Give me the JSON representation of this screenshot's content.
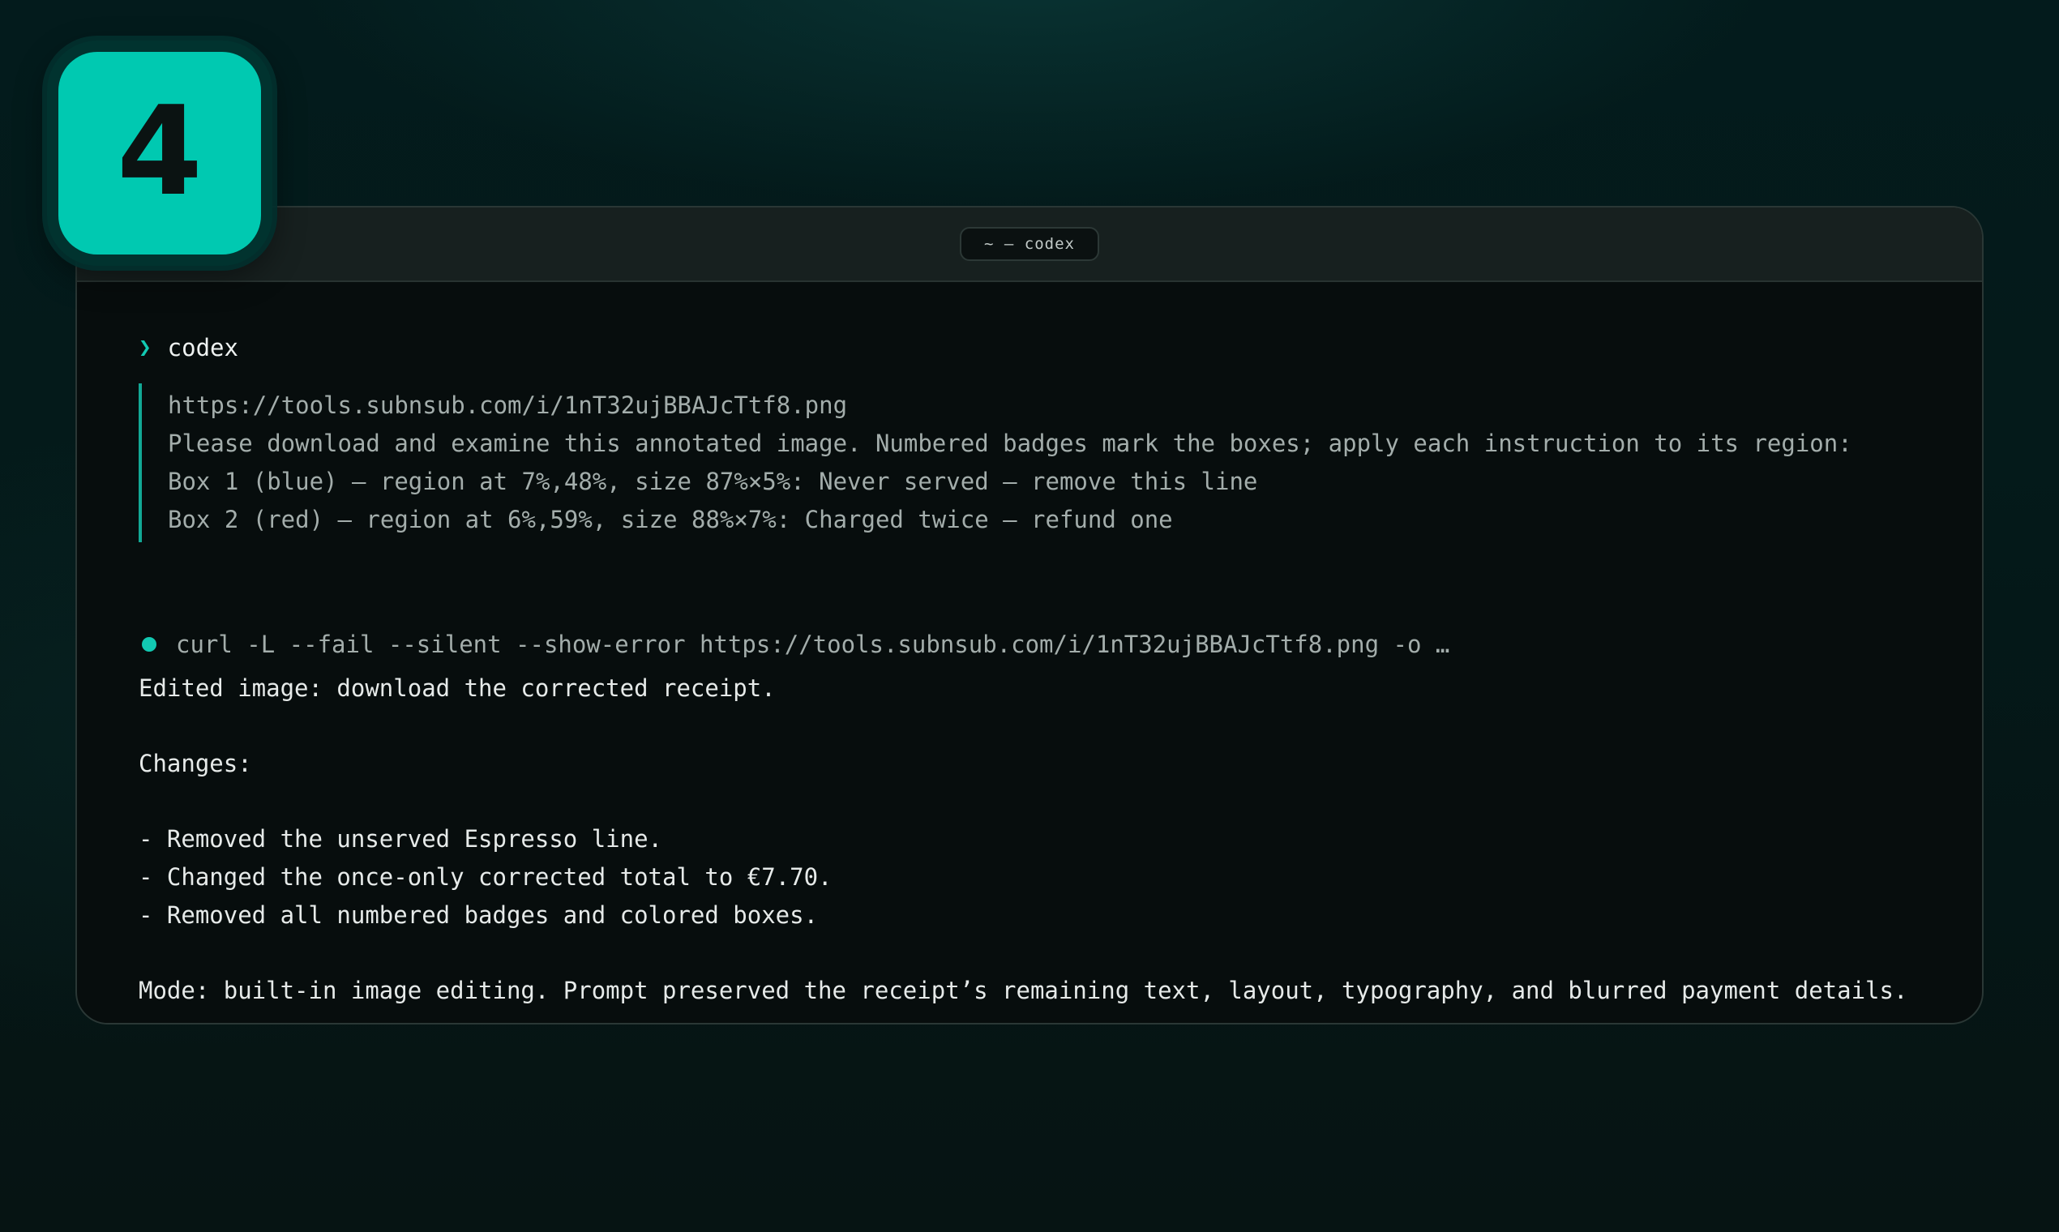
{
  "step": {
    "number": "4"
  },
  "window": {
    "title": "~ — codex"
  },
  "prompt": {
    "symbol": "❯",
    "command": "codex"
  },
  "message": {
    "lines": [
      "https://tools.subnsub.com/i/1nT32ujBBAJcTtf8.png",
      "Please download and examine this annotated image. Numbered badges mark the boxes; apply each instruction to its region:",
      "Box 1 (blue) — region at 7%,48%, size 87%×5%: Never served — remove this line",
      "Box 2 (red) — region at 6%,59%, size 88%×7%: Charged twice — refund one"
    ]
  },
  "tool_call": {
    "command": "curl -L --fail --silent --show-error https://tools.subnsub.com/i/1nT32ujBBAJcTtf8.png -o …"
  },
  "response": {
    "summary": "Edited image: download the corrected receipt.",
    "changes_heading": "Changes:",
    "changes": [
      "- Removed the unserved Espresso line.",
      "- Changed the once-only corrected total to €7.70.",
      "- Removed all numbered badges and colored boxes."
    ],
    "mode": "Mode: built-in image editing. Prompt preserved the receipt’s remaining text, layout, typography, and blurred payment details."
  },
  "colors": {
    "accent": "#00c9b1",
    "background": "#041a1a",
    "terminal": "#070d0d"
  }
}
